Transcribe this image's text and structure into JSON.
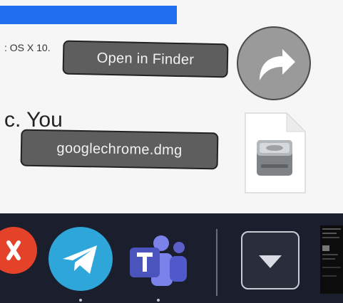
{
  "page": {
    "os_fragment": ": OS X 10.",
    "you_fragment": "c. You"
  },
  "tooltips": {
    "open_in_finder": "Open in Finder",
    "filename": "googlechrome.dmg"
  },
  "icons": {
    "share": "share-arrow-icon",
    "file": "dmg-file-icon",
    "downloads": "downloads-stack-icon"
  },
  "dock": {
    "apps": [
      "app-close-icon",
      "telegram-icon",
      "microsoft-teams-icon"
    ]
  },
  "colors": {
    "accent_blue": "#1f6ff0",
    "telegram": "#2ea6da",
    "teams": "#5b5fc7",
    "close_red": "#e5422a",
    "dock_bg": "#1b1e2c"
  }
}
